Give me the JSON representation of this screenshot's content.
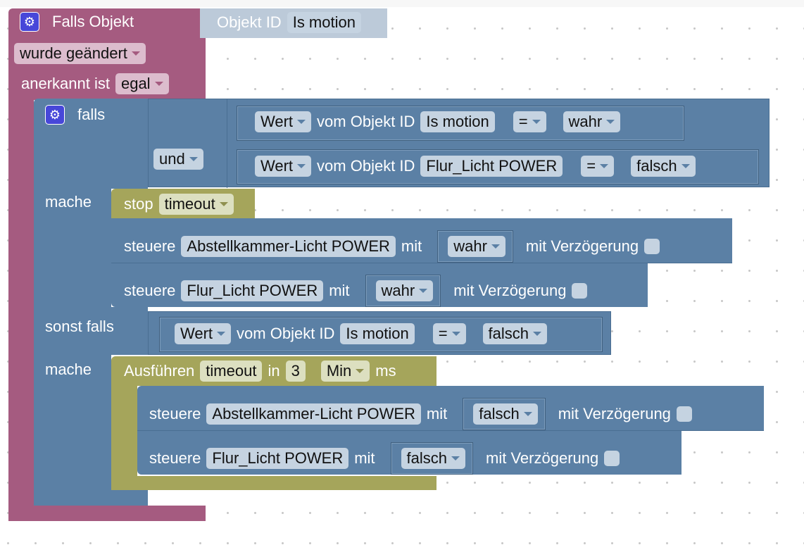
{
  "colors": {
    "trigger": "#a55b80",
    "logic": "#5b80a5",
    "timeout": "#a5a55b"
  },
  "trigger": {
    "title": "Falls Objekt",
    "objekt_id_label": "Objekt ID",
    "objekt_id_value": "Is motion",
    "event": "wurde geändert",
    "ack_label": "anerkannt ist",
    "ack_value": "egal",
    "icon": "gear-icon"
  },
  "if_block": {
    "falls": "falls",
    "mache": "mache",
    "sonst_falls": "sonst falls",
    "mache2": "mache",
    "operator": "und",
    "icon": "gear-icon",
    "cond1": {
      "mode": "Wert",
      "label": "vom Objekt ID",
      "object": "Is motion",
      "op": "=",
      "value": "wahr"
    },
    "cond2": {
      "mode": "Wert",
      "label": "vom Objekt ID",
      "object": "Flur_Licht POWER",
      "op": "=",
      "value": "falsch"
    },
    "cond3": {
      "mode": "Wert",
      "label": "vom Objekt ID",
      "object": "Is motion",
      "op": "=",
      "value": "falsch"
    }
  },
  "stop": {
    "label": "stop",
    "name": "timeout"
  },
  "actions1": [
    {
      "verb": "steuere",
      "object": "Abstellkammer-Licht POWER",
      "mit": "mit",
      "value": "wahr",
      "delay": "mit Verzögerung"
    },
    {
      "verb": "steuere",
      "object": "Flur_Licht POWER",
      "mit": "mit",
      "value": "wahr",
      "delay": "mit Verzögerung"
    }
  ],
  "timeout": {
    "label": "Ausführen",
    "name": "timeout",
    "in": "in",
    "value": "3",
    "unit": "Min",
    "ms": "ms"
  },
  "actions2": [
    {
      "verb": "steuere",
      "object": "Abstellkammer-Licht POWER",
      "mit": "mit",
      "value": "falsch",
      "delay": "mit Verzögerung"
    },
    {
      "verb": "steuere",
      "object": "Flur_Licht POWER",
      "mit": "mit",
      "value": "falsch",
      "delay": "mit Verzögerung"
    }
  ]
}
